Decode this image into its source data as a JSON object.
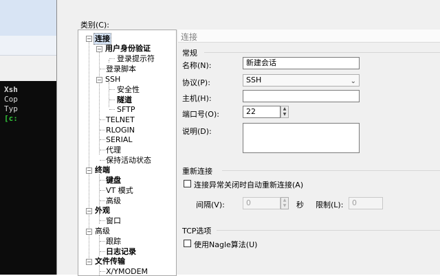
{
  "terminal": {
    "lines": [
      "Xsh",
      "Cop",
      "",
      "Typ"
    ],
    "prompt": "[c:"
  },
  "dialog": {
    "category_label": "类别(C):",
    "tree": {
      "connection": "连接",
      "user_auth": "用户身份验证",
      "login_prompt": "登录提示符",
      "login_script": "登录脚本",
      "ssh": "SSH",
      "security": "安全性",
      "tunnel": "隧道",
      "sftp": "SFTP",
      "telnet": "TELNET",
      "rlogin": "RLOGIN",
      "serial": "SERIAL",
      "proxy": "代理",
      "keepalive": "保持活动状态",
      "terminal": "终端",
      "keyboard": "键盘",
      "vt_mode": "VT 模式",
      "advanced": "高级",
      "appearance": "外观",
      "window": "窗口",
      "advanced2": "高级",
      "trace": "跟踪",
      "log": "日志记录",
      "file_transfer": "文件传输",
      "xymodem": "X/YMODEM"
    },
    "panel": {
      "title": "连接",
      "general": {
        "title": "常规",
        "name_label": "名称(N):",
        "name_value": "新建会话",
        "protocol_label": "协议(P):",
        "protocol_value": "SSH",
        "host_label": "主机(H):",
        "host_value": "",
        "port_label": "端口号(O):",
        "port_value": "22",
        "desc_label": "说明(D):",
        "desc_value": ""
      },
      "reconnect": {
        "title": "重新连接",
        "checkbox_label": "连接异常关闭时自动重新连接(A)",
        "interval_label": "间隔(V):",
        "interval_value": "0",
        "seconds": "秒",
        "limit_label": "限制(L):",
        "limit_value": "0"
      },
      "tcp": {
        "title": "TCP选项",
        "nagle_label": "使用Nagle算法(U)"
      }
    }
  }
}
